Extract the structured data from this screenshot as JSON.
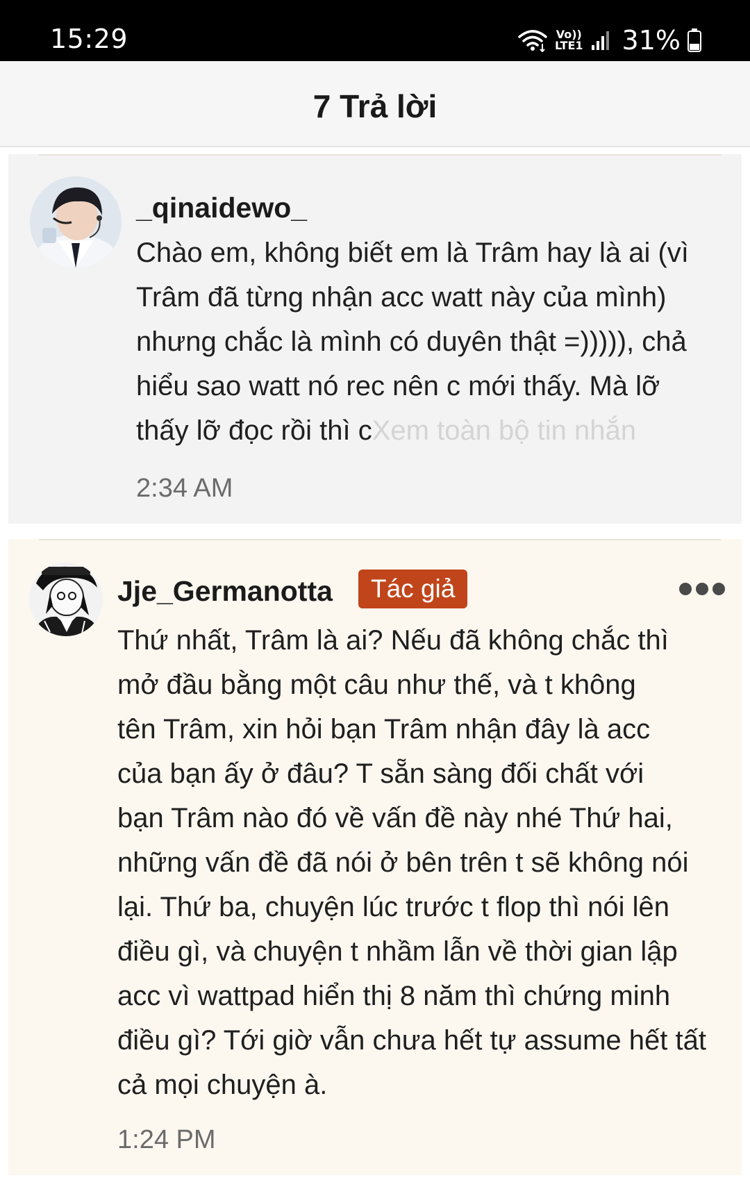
{
  "status_bar": {
    "time": "15:29",
    "network_top": "Vo))",
    "network_bottom": "LTE1",
    "battery": "31%",
    "icons": [
      "wifi-icon",
      "volte-icon",
      "signal-icon",
      "battery-icon"
    ]
  },
  "header": {
    "title": "7 Trả lời"
  },
  "comments": [
    {
      "username": "_qinaidewo_",
      "message_lines": [
        "Chào em, không biết em là Trâm hay là ai (vì",
        "Trâm đã từng nhận acc watt này của mình)",
        "nhưng chắc là mình có duyên thật =))))), chả",
        "hiểu sao watt nó rec nên c mới thấy. Mà lỡ"
      ],
      "message_last_line": "thấy lỡ đọc rồi thì c",
      "see_more": "Xem toàn bộ tin nhắn",
      "time": "2:34 AM",
      "background": "#f3f3f3"
    },
    {
      "username": "Jje_Germanotta",
      "badge": "Tác giả",
      "message_lines": [
        "Thứ nhất, Trâm là ai? Nếu đã không chắc thì",
        "mở đầu bằng một câu như thế, và t không",
        "tên Trâm, xin hỏi bạn Trâm nhận đây là acc",
        "của bạn ấy ở đâu? T sẵn sàng đối chất với",
        "bạn Trâm nào đó về vấn đề này nhé Thứ hai,",
        "những vấn đề đã nói ở bên trên t sẽ không nói",
        "lại. Thứ ba, chuyện lúc trước t flop thì nói lên",
        "điều gì, và chuyện t nhầm lẫn về thời gian lập",
        "acc vì wattpad hiển thị 8 năm thì chứng minh",
        "điều gì? Tới giờ vẫn chưa hết tự assume hết tất",
        "cả mọi chuyện à."
      ],
      "time": "1:24 PM",
      "background": "#fcf8f0",
      "badge_color": "#c0451a"
    }
  ],
  "colors": {
    "status_bar": "#000000",
    "header_bg": "#f6f6f6",
    "see_more_text": "#d4d4d4",
    "timestamp_text": "#6b6b6b"
  }
}
